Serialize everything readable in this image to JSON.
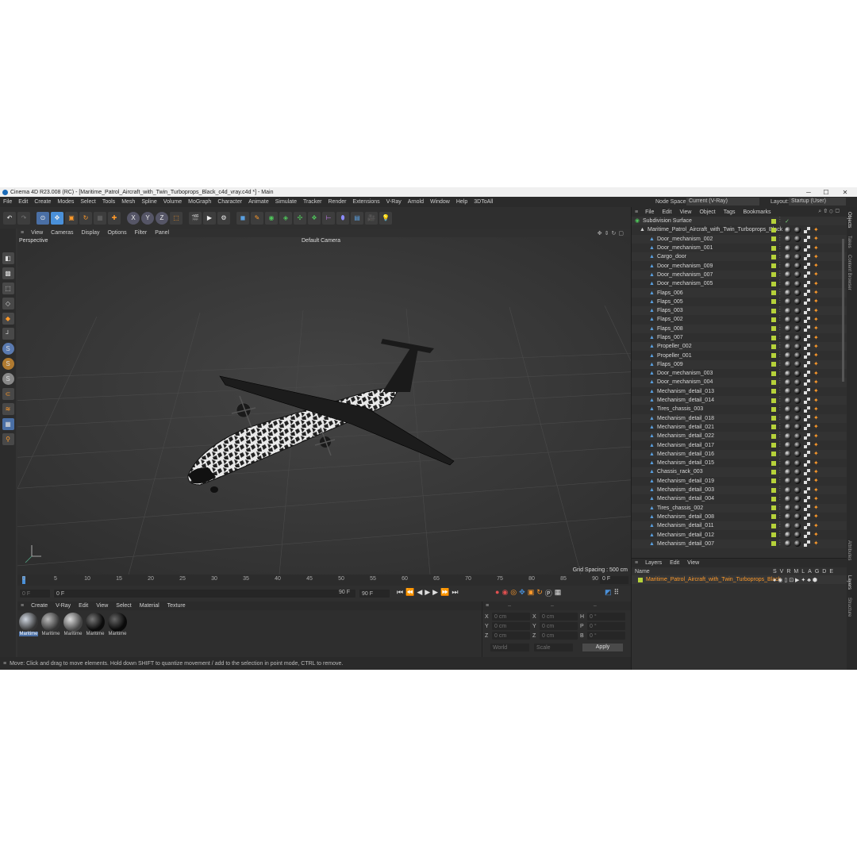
{
  "window": {
    "title": "Cinema 4D R23.008 (RC) - [Maritime_Patrol_Aircraft_with_Twin_Turboprops_Black_c4d_vray.c4d *] - Main",
    "minimize": "─",
    "maximize": "☐",
    "close": "✕"
  },
  "menu": [
    "File",
    "Edit",
    "Create",
    "Modes",
    "Select",
    "Tools",
    "Mesh",
    "Spline",
    "Volume",
    "MoGraph",
    "Character",
    "Animate",
    "Simulate",
    "Tracker",
    "Render",
    "Extensions",
    "V-Ray",
    "Arnold",
    "Window",
    "Help",
    "3DToAll"
  ],
  "nodespace": {
    "label": "Node Space:",
    "value": "Current (V-Ray)"
  },
  "layout": {
    "label": "Layout:",
    "value": "Startup (User)"
  },
  "viewport": {
    "menu": [
      "View",
      "Cameras",
      "Display",
      "Options",
      "Filter",
      "Panel"
    ],
    "name": "Perspective",
    "camera": "Default Camera",
    "grid_spacing": "Grid Spacing : 500 cm"
  },
  "timeline": {
    "ticks": [
      "0",
      "5",
      "10",
      "15",
      "20",
      "25",
      "30",
      "35",
      "40",
      "45",
      "50",
      "55",
      "60",
      "65",
      "70",
      "75",
      "80",
      "85",
      "90"
    ],
    "current_frame": "0 F",
    "start": "0 F",
    "range_start": "0 F",
    "range_end": "90 F",
    "end": "90 F"
  },
  "materials": {
    "menu": [
      "Create",
      "V-Ray",
      "Edit",
      "View",
      "Select",
      "Material",
      "Texture"
    ],
    "items": [
      "Maritime",
      "Maritime",
      "Maritime",
      "Maritime",
      "Maritime"
    ]
  },
  "coords": {
    "rows": [
      {
        "a": "X",
        "av": "0 cm",
        "b": "X",
        "bv": "0 cm",
        "c": "H",
        "cv": "0 °"
      },
      {
        "a": "Y",
        "av": "0 cm",
        "b": "Y",
        "bv": "0 cm",
        "c": "P",
        "cv": "0 °"
      },
      {
        "a": "Z",
        "av": "0 cm",
        "b": "Z",
        "bv": "0 cm",
        "c": "B",
        "cv": "0 °"
      }
    ],
    "world": "World",
    "scale": "Scale",
    "apply": "Apply"
  },
  "status": "Move: Click and drag to move elements. Hold down SHIFT to quantize movement / add to the selection in point mode, CTRL to remove.",
  "objects": {
    "menu": [
      "File",
      "Edit",
      "View",
      "Object",
      "Tags",
      "Bookmarks"
    ],
    "root": "Subdivision Surface",
    "group": "Maritime_Patrol_Aircraft_with_Twin_Turboprops_Black",
    "items": [
      "Door_mechanism_002",
      "Door_mechanism_001",
      "Cargo_door",
      "Door_mechanism_009",
      "Door_mechanism_007",
      "Door_mechanism_005",
      "Flaps_006",
      "Flaps_005",
      "Flaps_003",
      "Flaps_002",
      "Flaps_008",
      "Flaps_007",
      "Propeller_002",
      "Propeller_001",
      "Flaps_009",
      "Door_mechanism_003",
      "Door_mechanism_004",
      "Mechanism_detail_013",
      "Mechanism_detail_014",
      "Tires_chassis_003",
      "Mechanism_detail_018",
      "Mechanism_detail_021",
      "Mechanism_detail_022",
      "Mechanism_detail_017",
      "Mechanism_detail_016",
      "Mechanism_detail_015",
      "Chassis_rack_003",
      "Mechanism_detail_019",
      "Mechanism_detail_003",
      "Mechanism_detail_004",
      "Tires_chassis_002",
      "Mechanism_detail_008",
      "Mechanism_detail_011",
      "Mechanism_detail_012",
      "Mechanism_detail_007"
    ]
  },
  "layers": {
    "menu": [
      "Layers",
      "Edit",
      "View"
    ],
    "header_name": "Name",
    "header_flags": [
      "S",
      "V",
      "R",
      "M",
      "L",
      "A",
      "G",
      "D",
      "E"
    ],
    "item": "Maritime_Patrol_Aircraft_with_Twin_Turboprops_Black"
  },
  "side_tabs": [
    "Objects",
    "Takes",
    "Content Browser",
    "Attributes",
    "Layers",
    "Structure"
  ],
  "colors": {
    "accent": "#4a90d9",
    "orange": "#ff9a2a",
    "green": "#b6d23a"
  }
}
